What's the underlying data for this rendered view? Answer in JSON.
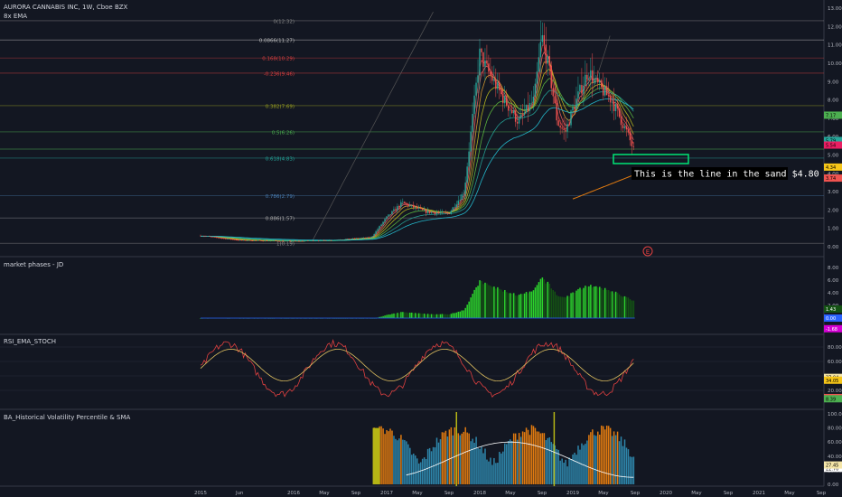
{
  "header": {
    "symbol_title": "AURORA CANNABIS INC, 1W, Cboe BZX",
    "indicator_label": "8x EMA"
  },
  "panes": {
    "market_phases_label": "market phases - JD",
    "rsi_label": "RSI_EMA_STOCH",
    "hv_label": "BA_Historical Volatility Percentile & SMA"
  },
  "annotation": {
    "text": "This is the line in the sand $4.80"
  },
  "event_marker": "E",
  "colors": {
    "background": "#131722",
    "grid": "#2a2e39",
    "candle_up": "#26a69a",
    "candle_down": "#ef5350",
    "phase_green": "#2bd42b",
    "phase_dark_green": "#145214",
    "phase_magenta": "#d400d4",
    "rsi_red": "#e04040",
    "rsi_yellow": "#e0c060",
    "hv_blue": "#2e86ab",
    "hv_orange": "#e07a10",
    "hv_darkred": "#7a1010",
    "hv_olive": "#b5b515",
    "annotation_box": "#00e676"
  },
  "chart_data": [
    {
      "type": "line",
      "title": "AURORA CANNABIS INC, 1W, Cboe BZX",
      "x_axis_ticks": [
        "2015",
        "Jun",
        "2016",
        "May",
        "Sep",
        "2017",
        "May",
        "Sep",
        "2018",
        "May",
        "Sep",
        "2019",
        "May",
        "Sep",
        "2020",
        "May",
        "Sep",
        "2021",
        "May",
        "Sep"
      ],
      "y_axis_ticks": [
        0.0,
        1.0,
        2.0,
        3.0,
        4.0,
        5.0,
        6.0,
        7.0,
        8.0,
        9.0,
        10.0,
        11.0,
        12.0,
        13.0
      ],
      "ylim": [
        0,
        13
      ],
      "fibonacci_levels": [
        {
          "label": "0(12.32)",
          "value": 12.32
        },
        {
          "label": "0.0866(11.27)",
          "value": 11.27
        },
        {
          "label": "0.168(10.29)",
          "value": 10.29
        },
        {
          "label": "-0.236(9.46)",
          "value": 9.46
        },
        {
          "label": "0.382(7.69)",
          "value": 7.69
        },
        {
          "label": "0.5(6.26)",
          "value": 6.26
        },
        {
          "label": "0.618(4.83)",
          "value": 4.83
        },
        {
          "label": "0.786(2.79)",
          "value": 2.79
        },
        {
          "label": "0.886(1.57)",
          "value": 1.57
        },
        {
          "label": "1(0.19)",
          "value": 0.19
        }
      ],
      "price_axis_tags": [
        "7.17",
        "5.71",
        "5.79",
        "5.54",
        "4.34",
        "3.74"
      ],
      "series": [
        {
          "name": "price",
          "x": [
            "2015-01",
            "2015-06",
            "2016-01",
            "2016-06",
            "2016-11",
            "2017-01",
            "2017-03",
            "2017-06",
            "2017-09",
            "2017-11",
            "2018-01",
            "2018-02",
            "2018-04",
            "2018-06",
            "2018-08",
            "2018-09",
            "2018-10",
            "2018-11",
            "2018-12",
            "2019-01",
            "2019-03",
            "2019-04",
            "2019-06",
            "2019-08",
            "2019-09"
          ],
          "values": [
            0.6,
            0.35,
            0.3,
            0.35,
            0.5,
            1.6,
            2.4,
            1.9,
            1.8,
            3.0,
            10.5,
            9.6,
            8.1,
            6.8,
            8.0,
            11.5,
            9.5,
            6.8,
            6.2,
            7.5,
            9.6,
            8.9,
            8.0,
            6.2,
            5.1
          ]
        }
      ]
    },
    {
      "type": "bar",
      "title": "market phases - JD",
      "y_axis_ticks": [
        2.0,
        4.0,
        6.0,
        8.0
      ],
      "price_axis_tags": [
        "1.43",
        "0.00",
        "-1.68"
      ]
    },
    {
      "type": "line",
      "title": "RSI_EMA_STOCH",
      "y_axis_ticks": [
        20.0,
        40.0,
        60.0,
        80.0
      ],
      "price_axis_tags": [
        "37.94",
        "34.05",
        "10.06",
        "8.39"
      ]
    },
    {
      "type": "bar",
      "title": "BA_Historical Volatility Percentile & SMA",
      "y_axis_ticks": [
        0.0,
        20.0,
        40.0,
        60.0,
        80.0,
        100.0
      ],
      "price_axis_tags": [
        "22.70",
        "27.45"
      ]
    }
  ]
}
